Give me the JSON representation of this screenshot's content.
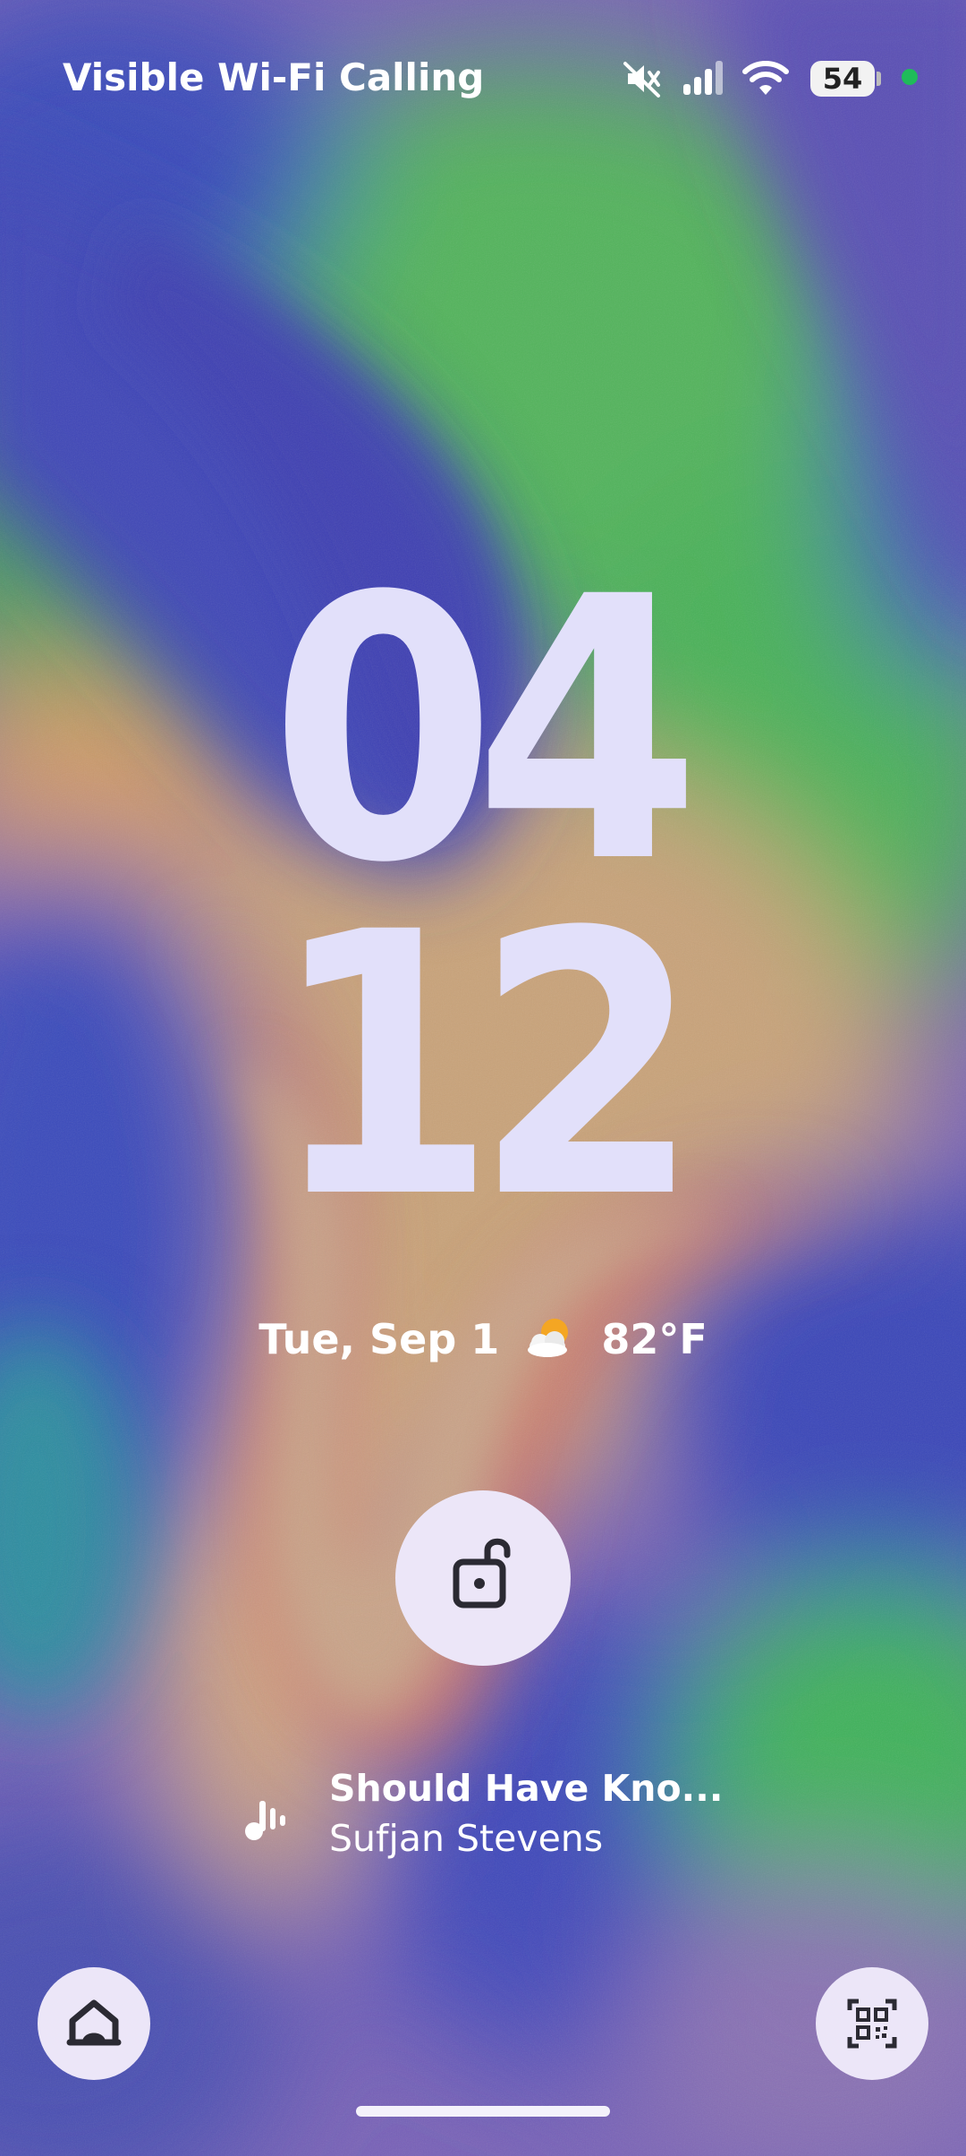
{
  "status_bar": {
    "carrier": "Visible Wi-Fi Calling",
    "battery_level": "54",
    "icons": [
      "mute-icon",
      "cell-signal-icon",
      "wifi-icon",
      "battery-icon",
      "privacy-indicator-dot"
    ],
    "privacy_dot_color": "#1fbb5a"
  },
  "clock": {
    "hours": "04",
    "minutes": "12",
    "color": "#e2e0fa"
  },
  "date_weather": {
    "date": "Tue, Sep 1",
    "weather_icon": "partly-cloudy-icon",
    "temperature": "82°F"
  },
  "unlock": {
    "icon": "unlock-padlock-icon"
  },
  "media": {
    "icon": "music-note-icon",
    "title": "Should Have Kno...",
    "artist": "Sufjan Stevens"
  },
  "shortcuts": {
    "left_icon": "home-icon",
    "right_icon": "qr-code-scanner-icon"
  }
}
